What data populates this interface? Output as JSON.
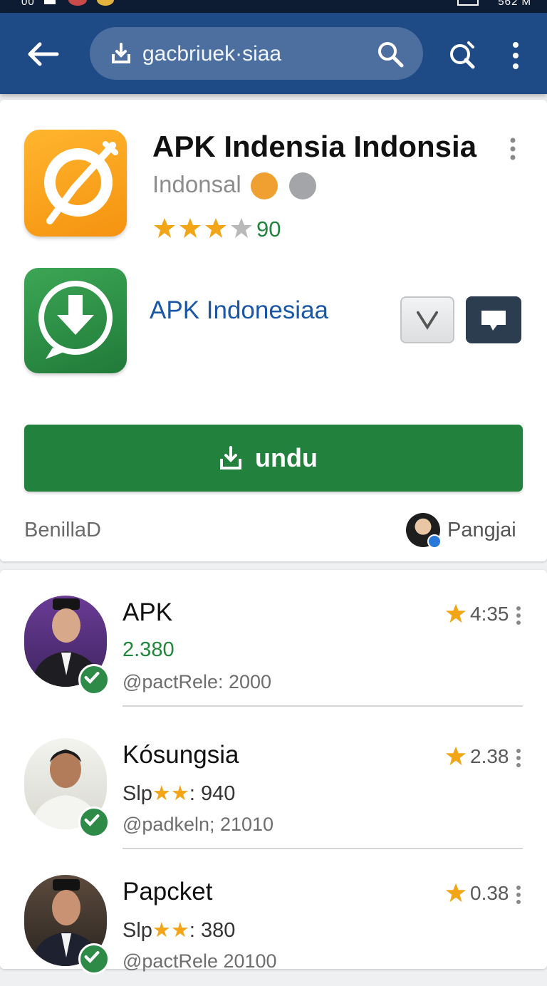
{
  "status": {
    "time": "00",
    "right_text": "562 M"
  },
  "appbar": {
    "url_text": "gacbriuek·siaa"
  },
  "app": {
    "title": "APK Indensia Indonsia",
    "developer": "Indonsal",
    "rating": "90",
    "rating_stars": 3,
    "subtitle": "APK Indonesiaa",
    "install_label": "undu",
    "footer_left": "BenillaD",
    "footer_right": "Pangjai"
  },
  "list": [
    {
      "name": "APK",
      "meta": "2.380",
      "meta_stars": 0,
      "handle": "@pactRele: 2000",
      "rating": "4:35",
      "meta_green": true
    },
    {
      "name": "Kósungsia",
      "meta_prefix": "Slp",
      "meta": ": 940",
      "meta_stars": 2,
      "handle": "@padkeln; 21010",
      "rating": "2.38",
      "meta_green": false
    },
    {
      "name": "Papcket",
      "meta_prefix": "Slp",
      "meta": ": 380",
      "meta_stars": 2,
      "handle": "@pactRele 20100",
      "rating": "0.38",
      "meta_green": false
    }
  ],
  "colors": {
    "appbar": "#1e4a86",
    "install": "#23813e",
    "accent_blue": "#1a58a6",
    "star": "#f2a516"
  },
  "icons": [
    "back-arrow-icon",
    "download-icon",
    "search-icon",
    "quick-search-icon",
    "more-vert-icon",
    "star-icon",
    "verified-check-icon"
  ]
}
